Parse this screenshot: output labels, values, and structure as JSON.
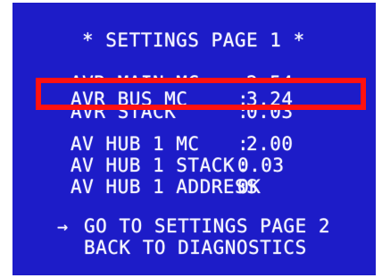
{
  "screen": {
    "title": "* SETTINGS PAGE 1 *",
    "rows": [
      {
        "label": "AVR MAIN MC",
        "value": "2.54"
      },
      {
        "label": "AVR BUS MC",
        "value": "3.24"
      },
      {
        "label": "AVR STACK",
        "value": "0.03"
      },
      {
        "label": "AV HUB 1 MC",
        "value": "2.00"
      },
      {
        "label": "AV HUB 1 STACK",
        "value": "0.03"
      },
      {
        "label": "AV HUB 1 ADDRESS",
        "value": "OK"
      }
    ],
    "separator": ":",
    "menu": {
      "cursor": "→",
      "items": [
        "GO TO SETTINGS PAGE 2",
        "BACK TO DIAGNOSTICS"
      ]
    }
  },
  "colors": {
    "background": "#1d1cc8",
    "text": "#f4f4ff",
    "highlight_border": "#ff1111"
  }
}
